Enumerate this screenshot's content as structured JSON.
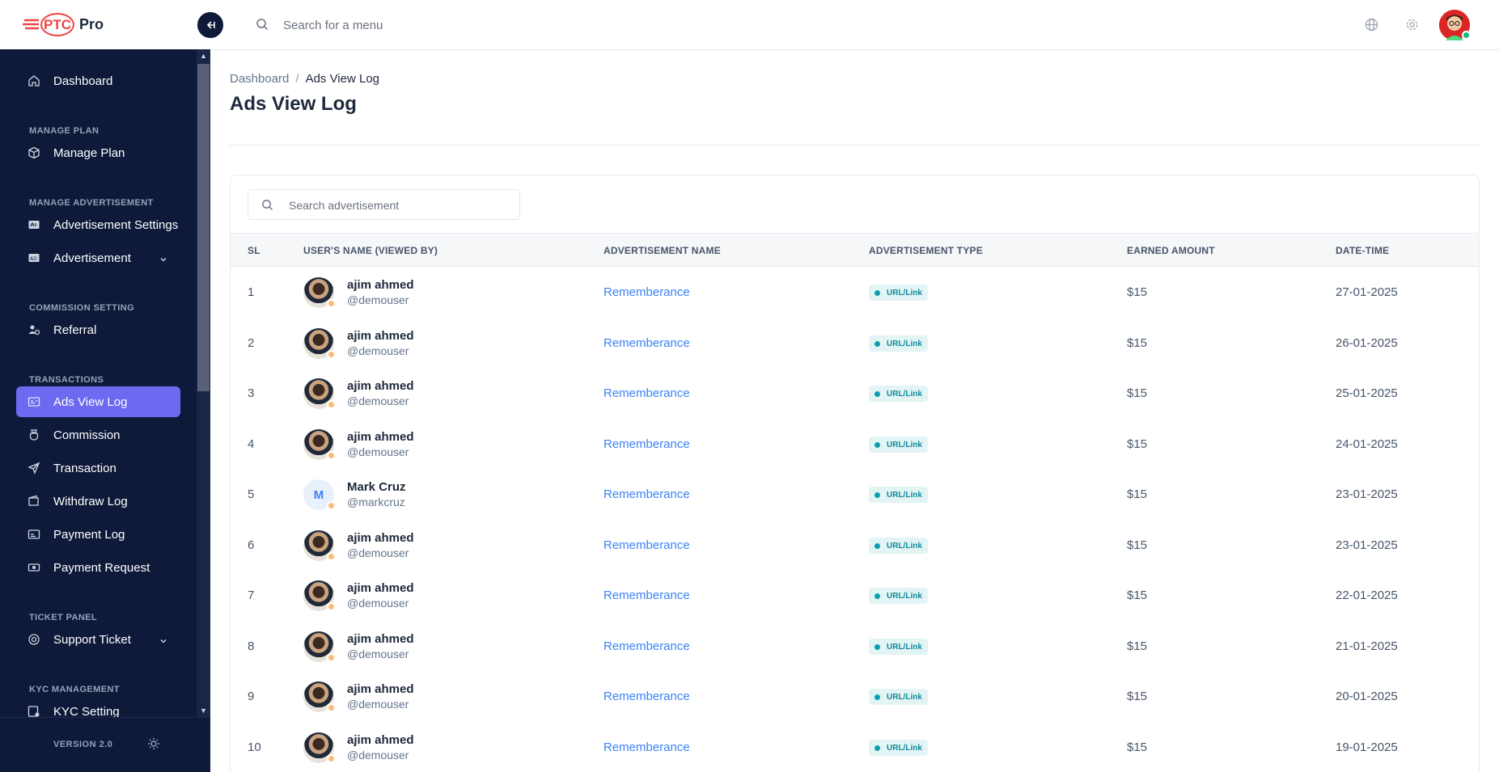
{
  "brand": {
    "logo_mark": "PTC",
    "logo_suffix": "Pro"
  },
  "sidebar": {
    "items": [
      {
        "type": "item",
        "label": "Dashboard",
        "icon": "home-icon"
      },
      {
        "type": "section",
        "label": "MANAGE PLAN"
      },
      {
        "type": "item",
        "label": "Manage Plan",
        "icon": "box-icon"
      },
      {
        "type": "section",
        "label": "MANAGE ADVERTISEMENT"
      },
      {
        "type": "item",
        "label": "Advertisement Settings",
        "icon": "ad-settings-icon"
      },
      {
        "type": "item",
        "label": "Advertisement",
        "icon": "ad-icon",
        "has_children": true
      },
      {
        "type": "section",
        "label": "COMMISSION SETTING"
      },
      {
        "type": "item",
        "label": "Referral",
        "icon": "referral-icon"
      },
      {
        "type": "section",
        "label": "TRANSACTIONS"
      },
      {
        "type": "item",
        "label": "Ads View Log",
        "icon": "ads-log-icon",
        "active": true
      },
      {
        "type": "item",
        "label": "Commission",
        "icon": "commission-icon"
      },
      {
        "type": "item",
        "label": "Transaction",
        "icon": "send-icon"
      },
      {
        "type": "item",
        "label": "Withdraw Log",
        "icon": "wallet-icon"
      },
      {
        "type": "item",
        "label": "Payment Log",
        "icon": "payment-icon"
      },
      {
        "type": "item",
        "label": "Payment Request",
        "icon": "cash-icon"
      },
      {
        "type": "section",
        "label": "TICKET PANEL"
      },
      {
        "type": "item",
        "label": "Support Ticket",
        "icon": "support-icon",
        "has_children": true
      },
      {
        "type": "section",
        "label": "KYC MANAGEMENT"
      },
      {
        "type": "item",
        "label": "KYC Setting",
        "icon": "kyc-icon"
      }
    ],
    "version": "VERSION 2.0",
    "active_color": "#6d69f0",
    "bg_color": "#0f1a3a"
  },
  "topbar": {
    "search_placeholder": "Search for a menu"
  },
  "breadcrumb": {
    "parent": "Dashboard",
    "separator": "/",
    "current": "Ads View Log"
  },
  "page_title": "Ads View Log",
  "table": {
    "search_placeholder": "Search advertisement",
    "columns": [
      "SL",
      "USER'S NAME (VIEWED BY)",
      "ADVERTISEMENT NAME",
      "ADVERTISEMENT TYPE",
      "EARNED AMOUNT",
      "DATE-TIME"
    ],
    "rows": [
      {
        "sl": "1",
        "name": "ajim ahmed",
        "handle": "@demouser",
        "avatar": "image",
        "ad": "Rememberance",
        "type": "URL/Link",
        "amount": "$15",
        "date": "27-01-2025"
      },
      {
        "sl": "2",
        "name": "ajim ahmed",
        "handle": "@demouser",
        "avatar": "image",
        "ad": "Rememberance",
        "type": "URL/Link",
        "amount": "$15",
        "date": "26-01-2025"
      },
      {
        "sl": "3",
        "name": "ajim ahmed",
        "handle": "@demouser",
        "avatar": "image",
        "ad": "Rememberance",
        "type": "URL/Link",
        "amount": "$15",
        "date": "25-01-2025"
      },
      {
        "sl": "4",
        "name": "ajim ahmed",
        "handle": "@demouser",
        "avatar": "image",
        "ad": "Rememberance",
        "type": "URL/Link",
        "amount": "$15",
        "date": "24-01-2025"
      },
      {
        "sl": "5",
        "name": "Mark Cruz",
        "handle": "@markcruz",
        "avatar": "M",
        "ad": "Rememberance",
        "type": "URL/Link",
        "amount": "$15",
        "date": "23-01-2025"
      },
      {
        "sl": "6",
        "name": "ajim ahmed",
        "handle": "@demouser",
        "avatar": "image",
        "ad": "Rememberance",
        "type": "URL/Link",
        "amount": "$15",
        "date": "23-01-2025"
      },
      {
        "sl": "7",
        "name": "ajim ahmed",
        "handle": "@demouser",
        "avatar": "image",
        "ad": "Rememberance",
        "type": "URL/Link",
        "amount": "$15",
        "date": "22-01-2025"
      },
      {
        "sl": "8",
        "name": "ajim ahmed",
        "handle": "@demouser",
        "avatar": "image",
        "ad": "Rememberance",
        "type": "URL/Link",
        "amount": "$15",
        "date": "21-01-2025"
      },
      {
        "sl": "9",
        "name": "ajim ahmed",
        "handle": "@demouser",
        "avatar": "image",
        "ad": "Rememberance",
        "type": "URL/Link",
        "amount": "$15",
        "date": "20-01-2025"
      },
      {
        "sl": "10",
        "name": "ajim ahmed",
        "handle": "@demouser",
        "avatar": "image",
        "ad": "Rememberance",
        "type": "URL/Link",
        "amount": "$15",
        "date": "19-01-2025"
      }
    ]
  }
}
